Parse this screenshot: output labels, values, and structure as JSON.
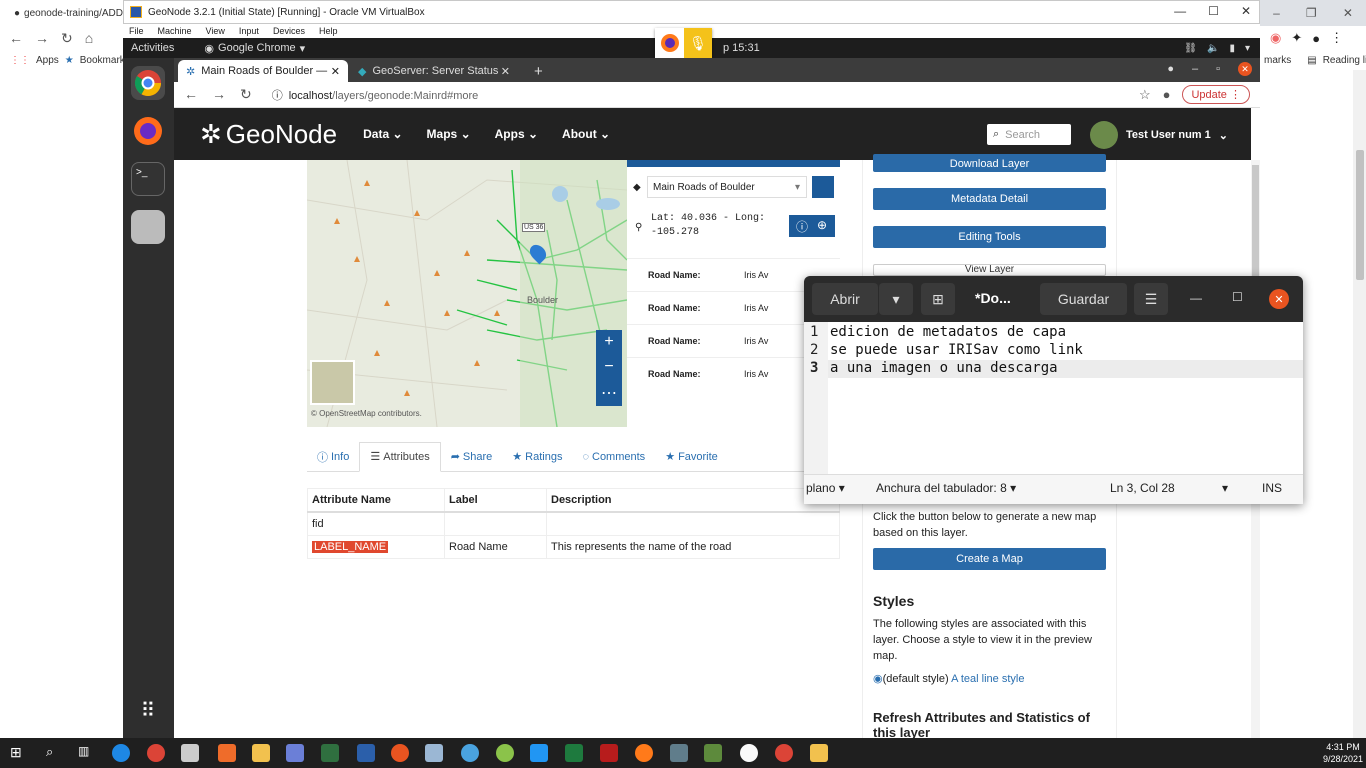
{
  "host": {
    "tab_title": "geonode-training/ADDI",
    "bookmarks_apps": "Apps",
    "bookmarks_bookmarks": "Bookmarks",
    "bookmarks_marks": "marks",
    "bookmarks_reading": "Reading list"
  },
  "vbox": {
    "title": "GeoNode 3.2.1 (Initial State) [Running] - Oracle VM VirtualBox",
    "menu": [
      "File",
      "Machine",
      "View",
      "Input",
      "Devices",
      "Help"
    ]
  },
  "ubuntu": {
    "activities": "Activities",
    "app": "Google Chrome",
    "clock": "p 15:31"
  },
  "chrome": {
    "tabs": [
      "Main Roads of Boulder —",
      "GeoServer: Server Status"
    ],
    "url_host": "localhost",
    "url_path": "/layers/geonode:Mainrd#more",
    "update": "Update"
  },
  "geonode": {
    "logo": "GeoNode",
    "menu": [
      "Data",
      "Maps",
      "Apps",
      "About"
    ],
    "search_placeholder": "Search",
    "user": "Test User num 1"
  },
  "map": {
    "attribution": "© OpenStreetMap contributors.",
    "place": "Boulder",
    "road_shield": "US 36"
  },
  "identify": {
    "layer": "Main Roads of Boulder",
    "coords": "Lat: 40.036 - Long: -105.278",
    "rows": [
      {
        "k": "Road Name:",
        "v": "Iris Av"
      },
      {
        "k": "Road Name:",
        "v": "Iris Av"
      },
      {
        "k": "Road Name:",
        "v": "Iris Av"
      },
      {
        "k": "Road Name:",
        "v": "Iris Av"
      }
    ]
  },
  "tabs": [
    "Info",
    "Attributes",
    "Share",
    "Ratings",
    "Comments",
    "Favorite"
  ],
  "attributes": {
    "headers": [
      "Attribute Name",
      "Label",
      "Description"
    ],
    "rows": [
      [
        "fid",
        "",
        ""
      ],
      [
        "LABEL_NAME",
        "Road Name",
        "This represents the name of the road"
      ]
    ]
  },
  "side": {
    "download": "Download Layer",
    "metadata": "Metadata Detail",
    "editing": "Editing Tools",
    "view": "View Layer",
    "map_text": "Click the button below to generate a new map based on this layer.",
    "create_map": "Create a Map",
    "styles_h": "Styles",
    "styles_t": "The following styles are associated with this layer. Choose a style to view it in the preview map.",
    "style_default": "(default style)",
    "style_link": "A teal line style",
    "refresh": "Refresh Attributes and Statistics of this layer"
  },
  "gedit": {
    "open": "Abrir",
    "title": "*Do...",
    "save": "Guardar",
    "lines": [
      "edicion de metadatos de capa",
      "se puede usar IRISav como link",
      "a una imagen o una descarga"
    ],
    "status_lang": "plano",
    "status_tab": "Anchura del tabulador: 8",
    "status_pos": "Ln 3, Col 28",
    "status_mode": "INS"
  },
  "taskbar": {
    "time": "4:31 PM",
    "date": "9/28/2021"
  }
}
